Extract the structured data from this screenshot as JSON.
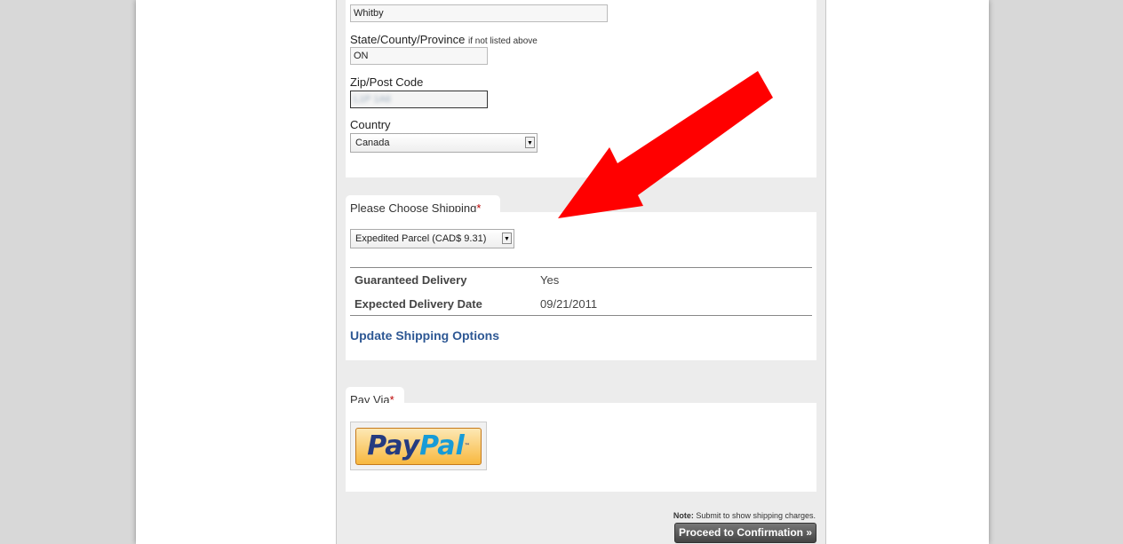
{
  "address": {
    "city_value": "Whitby",
    "state_label": "State/County/Province",
    "state_hint": "if not listed above",
    "state_value": "ON",
    "zip_label": "Zip/Post Code",
    "zip_value": "L1P 1A6",
    "country_label": "Country",
    "country_value": "Canada"
  },
  "shipping": {
    "section_label": "Please Choose Shipping",
    "required_mark": "*",
    "selected_option": "Expedited Parcel (CAD$ 9.31)",
    "guaranteed_label": "Guaranteed Delivery",
    "guaranteed_value": "Yes",
    "expected_label": "Expected Delivery Date",
    "expected_value": "09/21/2011",
    "update_link": "Update Shipping Options"
  },
  "payment": {
    "section_label": "Pay Via",
    "required_mark": "*",
    "paypal_part1": "Pay",
    "paypal_part2": "Pal",
    "paypal_tm": "™"
  },
  "footer": {
    "note_label": "Note:",
    "note_text": " Submit to show shipping charges.",
    "proceed_button": "Proceed to Confirmation »"
  },
  "colors": {
    "arrow": "#ff0000",
    "link": "#2e5894",
    "required": "#bb0000"
  },
  "icons": [
    "dropdown-arrow-icon",
    "red-arrow-annotation"
  ]
}
